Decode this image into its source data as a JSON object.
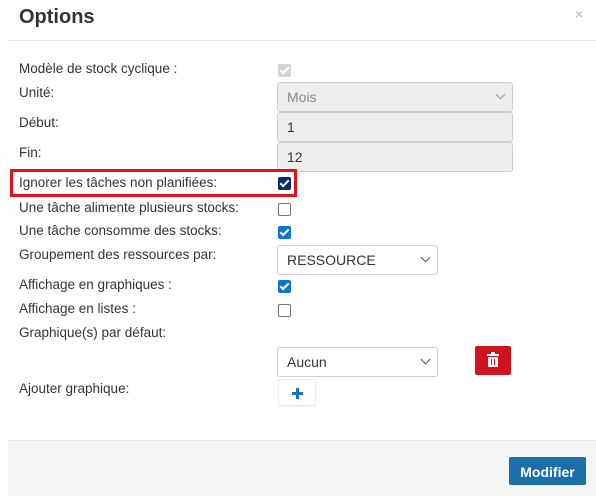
{
  "dialog": {
    "title": "Options",
    "close_glyph": "×"
  },
  "rows": {
    "cyclic_stock": {
      "label": "Modèle de stock cyclique :",
      "checked": true,
      "disabled": true
    },
    "unit": {
      "label": "Unité:",
      "value": "Mois"
    },
    "start": {
      "label": "Début:",
      "value": "1"
    },
    "end": {
      "label": "Fin:",
      "value": "12"
    },
    "ignore_unplanned": {
      "label": "Ignorer les tâches non planifiées:",
      "checked": true,
      "highlighted": true
    },
    "feeds_multiple": {
      "label": "Une tâche alimente plusieurs stocks:",
      "checked": false
    },
    "consumes": {
      "label": "Une tâche consomme des stocks:",
      "checked": true
    },
    "grouping": {
      "label": "Groupement des ressources par:",
      "value": "RESSOURCE"
    },
    "graph_display": {
      "label": "Affichage en graphiques :",
      "checked": true
    },
    "list_display": {
      "label": "Affichage en listes :",
      "checked": false
    },
    "default_graphs": {
      "label": "Graphique(s) par défaut:",
      "value": "Aucun"
    },
    "add_graph": {
      "label": "Ajouter graphique:"
    }
  },
  "icons": {
    "delete": "trash-icon",
    "add": "plus-icon"
  },
  "footer": {
    "submit_label": "Modifier"
  },
  "colors": {
    "highlight": "#e0141e",
    "checkbox": "#0b75d1",
    "delete_button": "#d0141f",
    "primary_button": "#1a6fa8"
  }
}
